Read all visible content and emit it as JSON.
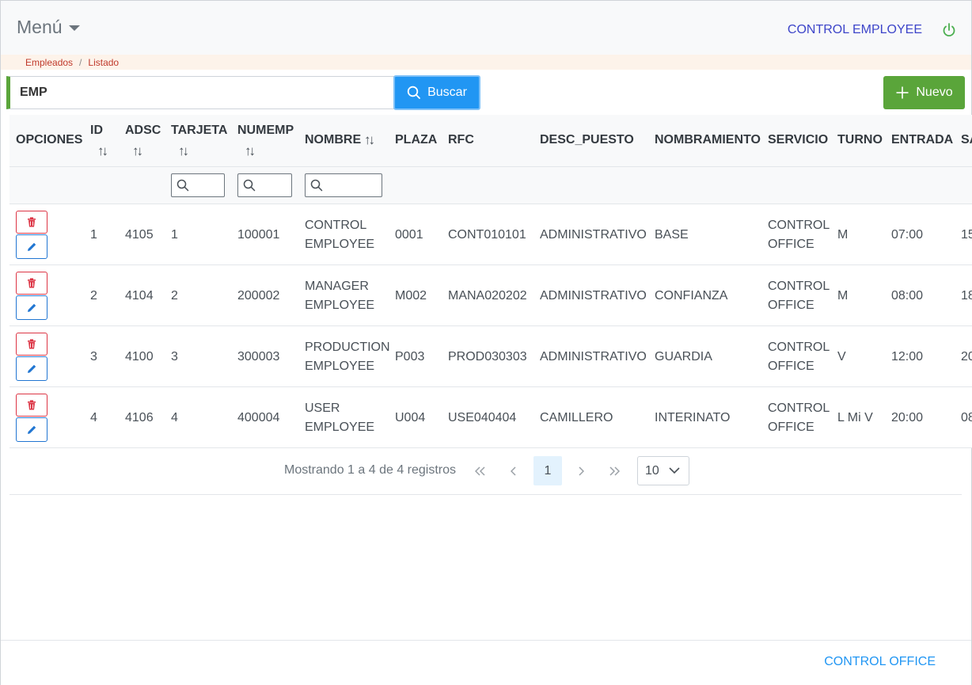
{
  "header": {
    "menu_label": "Menú",
    "user_name": "CONTROL EMPLOYEE"
  },
  "breadcrumb": {
    "items": [
      "Empleados",
      "Listado"
    ],
    "separator": "/"
  },
  "search": {
    "value": "EMP",
    "button_label": "Buscar"
  },
  "toolbar": {
    "new_label": "Nuevo"
  },
  "table": {
    "columns": [
      "OPCIONES",
      "ID",
      "ADSC",
      "TARJETA",
      "NUMEMP",
      "NOMBRE",
      "PLAZA",
      "RFC",
      "DESC_PUESTO",
      "NOMBRAMIENTO",
      "SERVICIO",
      "TURNO",
      "ENTRADA",
      "SA"
    ],
    "sort_icon": "↑↓",
    "rows": [
      {
        "id": "1",
        "adsc": "4105",
        "tarjeta": "1",
        "numemp": "100001",
        "nombre_1": "CONTROL",
        "nombre_2": "EMPLOYEE",
        "plaza": "0001",
        "rfc": "CONT010101",
        "desc_puesto": "ADMINISTRATIVO",
        "nombramiento": "BASE",
        "servicio_1": "CONTROL",
        "servicio_2": "OFFICE",
        "turno": "M",
        "entrada": "07:00",
        "sa": "15"
      },
      {
        "id": "2",
        "adsc": "4104",
        "tarjeta": "2",
        "numemp": "200002",
        "nombre_1": "MANAGER",
        "nombre_2": "EMPLOYEE",
        "plaza": "M002",
        "rfc": "MANA020202",
        "desc_puesto": "ADMINISTRATIVO",
        "nombramiento": "CONFIANZA",
        "servicio_1": "CONTROL",
        "servicio_2": "OFFICE",
        "turno": "M",
        "entrada": "08:00",
        "sa": "18"
      },
      {
        "id": "3",
        "adsc": "4100",
        "tarjeta": "3",
        "numemp": "300003",
        "nombre_1": "PRODUCTION",
        "nombre_2": "EMPLOYEE",
        "plaza": "P003",
        "rfc": "PROD030303",
        "desc_puesto": "ADMINISTRATIVO",
        "nombramiento": "GUARDIA",
        "servicio_1": "CONTROL",
        "servicio_2": "OFFICE",
        "turno": "V",
        "entrada": "12:00",
        "sa": "20"
      },
      {
        "id": "4",
        "adsc": "4106",
        "tarjeta": "4",
        "numemp": "400004",
        "nombre_1": "USER",
        "nombre_2": "EMPLOYEE",
        "plaza": "U004",
        "rfc": "USE040404",
        "desc_puesto": "CAMILLERO",
        "nombramiento": "INTERINATO",
        "servicio_1": "CONTROL",
        "servicio_2": "OFFICE",
        "turno": "L Mi V",
        "entrada": "20:00",
        "sa": "08"
      }
    ]
  },
  "paginator": {
    "info": "Mostrando 1 a 4 de 4 registros",
    "first": "«",
    "prev": "‹",
    "current_page": "1",
    "next": "›",
    "last": "»",
    "rows_per_page": "10"
  },
  "footer": {
    "text": "CONTROL OFFICE"
  },
  "colors": {
    "primary": "#2196f3",
    "success": "#5aa53a",
    "danger": "#dc3545",
    "link": "#3d45c9"
  },
  "icons": [
    "caret-down-icon",
    "power-icon",
    "search-icon",
    "plus-icon",
    "sort-icon",
    "trash-icon",
    "pencil-icon",
    "chevron-down-icon"
  ]
}
